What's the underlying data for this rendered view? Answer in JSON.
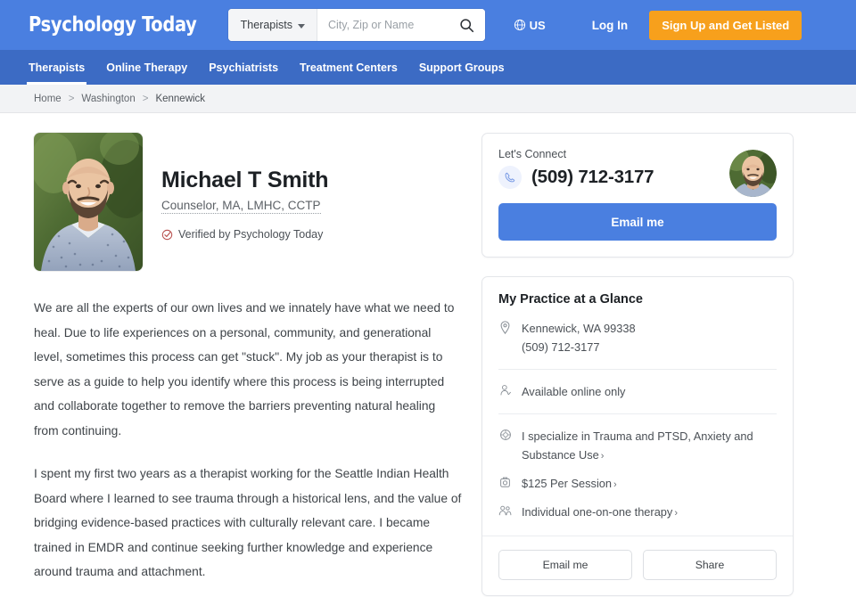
{
  "header": {
    "logo": "Psychology Today",
    "search": {
      "type_label": "Therapists",
      "placeholder": "City, Zip or Name",
      "value": "",
      "search_icon": "search-icon",
      "caret_icon": "chevron-down-icon"
    },
    "locale": {
      "label": "US",
      "icon": "globe-icon"
    },
    "login_label": "Log In",
    "signup_label": "Sign Up and Get Listed",
    "colors": {
      "header_blue": "#4a7fe0",
      "nav_blue": "#3c6bc4",
      "signup_orange": "#f7a01c"
    }
  },
  "nav": {
    "items": [
      {
        "label": "Therapists",
        "active": true
      },
      {
        "label": "Online Therapy",
        "active": false
      },
      {
        "label": "Psychiatrists",
        "active": false
      },
      {
        "label": "Treatment Centers",
        "active": false
      },
      {
        "label": "Support Groups",
        "active": false
      }
    ]
  },
  "breadcrumb": {
    "items": [
      "Home",
      "Washington",
      "Kennewick"
    ],
    "separator": ">"
  },
  "profile": {
    "name": "Michael T Smith",
    "credentials": "Counselor, MA, LMHC, CCTP",
    "verified_text": "Verified by Psychology Today",
    "verified_icon": "verified-check-icon",
    "portrait_alt": "profile-portrait",
    "bio_paragraphs": [
      "We are all the experts of our own lives and we innately have what we need to heal. Due to life experiences on a personal, community, and generational level, sometimes this process can get \"stuck\". My job as your therapist is to serve as a guide to help you identify where this process is being interrupted and collaborate together to remove the barriers preventing natural healing from continuing.",
      "I spent my first two years as a therapist working for the Seattle Indian Health Board where I learned to see trauma through a historical lens, and the value of bridging evidence-based practices with culturally relevant care. I became trained in EMDR and continue seeking further knowledge and experience around trauma and attachment."
    ]
  },
  "connect_card": {
    "label": "Let's Connect",
    "phone": "(509) 712-3177",
    "phone_icon": "phone-icon",
    "avatar_alt": "therapist-avatar",
    "email_button": "Email me"
  },
  "glance_card": {
    "title": "My Practice at a Glance",
    "location": {
      "icon": "location-pin-icon",
      "address": "Kennewick, WA 99338",
      "phone": "(509) 712-3177"
    },
    "availability": {
      "icon": "person-check-icon",
      "text": "Available online only"
    },
    "details": [
      {
        "icon": "target-icon",
        "text": "I specialize in Trauma and PTSD, Anxiety and Substance Use",
        "chevron": "›"
      },
      {
        "icon": "price-tag-icon",
        "text": "$125 Per Session",
        "chevron": "›"
      },
      {
        "icon": "people-icon",
        "text": "Individual one-on-one therapy",
        "chevron": "›"
      }
    ],
    "actions": [
      {
        "label": "Email me"
      },
      {
        "label": "Share"
      }
    ]
  }
}
